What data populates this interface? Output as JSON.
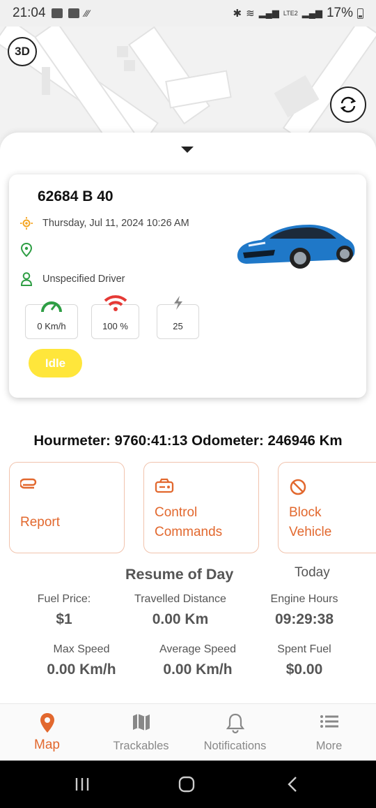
{
  "status_bar": {
    "time": "21:04",
    "battery": "17%",
    "network": "LTE2"
  },
  "map": {
    "mode_button": "3D",
    "refresh_icon": "refresh-icon"
  },
  "vehicle": {
    "plate": "62684 B 40",
    "datetime": "Thursday, Jul 11, 2024 10:26 AM",
    "location": "",
    "driver": "Unspecified Driver",
    "speed": "0 Km/h",
    "signal": "100 %",
    "power": "25",
    "status": "Idle",
    "colors": {
      "signal": "#e53935",
      "speed": "#2e9e44",
      "status": "#ffe63b",
      "sun": "#f5a623"
    }
  },
  "meters": {
    "text": "Hourmeter: 9760:41:13 Odometer: 246946 Km"
  },
  "actions": [
    {
      "label_line1": "Report",
      "label_line2": "",
      "icon": "paperclip-icon"
    },
    {
      "label_line1": "Control",
      "label_line2": "Commands",
      "icon": "control-panel-icon"
    },
    {
      "label_line1": "Block",
      "label_line2": "Vehicle",
      "icon": "block-icon"
    }
  ],
  "resume": {
    "title": "Resume of Day",
    "period": "Today",
    "stats": [
      {
        "label": "Fuel Price:",
        "value": "$1"
      },
      {
        "label": "Travelled Distance",
        "value": "0.00 Km"
      },
      {
        "label": "Engine Hours",
        "value": "09:29:38"
      },
      {
        "label": "Max Speed",
        "value": "0.00 Km/h"
      },
      {
        "label": "Average Speed",
        "value": "0.00 Km/h"
      },
      {
        "label": "Spent Fuel",
        "value": "$0.00"
      }
    ]
  },
  "bottom_nav": [
    {
      "label": "Map",
      "icon": "map-pin-icon",
      "active": true
    },
    {
      "label": "Trackables",
      "icon": "map-icon",
      "active": false
    },
    {
      "label": "Notifications",
      "icon": "bell-icon",
      "active": false
    },
    {
      "label": "More",
      "icon": "menu-icon",
      "active": false
    }
  ],
  "accent_color": "#e2682e"
}
